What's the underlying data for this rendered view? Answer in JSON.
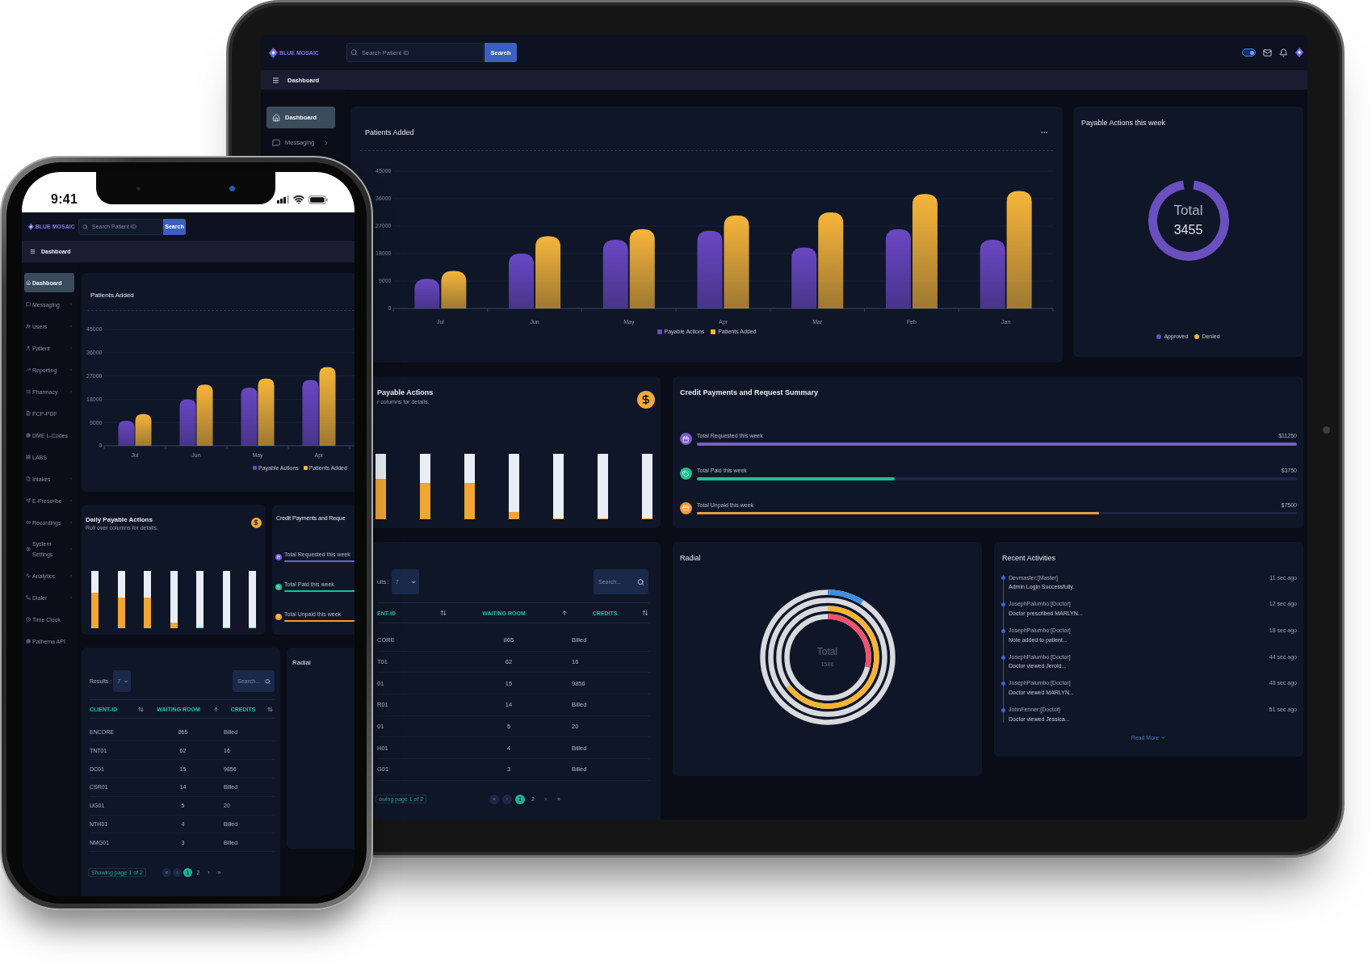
{
  "tablet": {
    "topbar": {
      "logo": "BLUE MOSAIC",
      "search_placeholder": "Search Patient ID",
      "search_button": "Search",
      "theme_toggle": {
        "on": true
      }
    },
    "breadcrumb": "Dashboard",
    "sidebar": [
      {
        "label": "Dashboard",
        "selected": true,
        "expandable": false
      },
      {
        "label": "Messaging",
        "selected": false,
        "expandable": true
      }
    ],
    "patients_added": {
      "title": "Patients Added",
      "chart_data": {
        "type": "bar",
        "categories": [
          "Jul",
          "Jun",
          "May",
          "Apr",
          "Mar",
          "Feb",
          "Jan"
        ],
        "series": [
          {
            "name": "Payable Actions",
            "color": "#6a47c4",
            "values": [
              9700,
              18000,
              22500,
              25500,
              20000,
              26000,
              22500
            ]
          },
          {
            "name": "Patients Added",
            "color": "#f6b53a",
            "values": [
              12300,
              23700,
              26000,
              30500,
              31500,
              37500,
              38500
            ]
          }
        ],
        "ylim": [
          0,
          45000
        ],
        "yticks": [
          0,
          9000,
          18000,
          27000,
          36000,
          45000
        ],
        "grid": true
      }
    },
    "payable_week": {
      "title": "Payable Actions this week",
      "total_label": "Total",
      "total_value": "3455",
      "legend": [
        {
          "label": "Approved",
          "color": "#6a4fbf"
        },
        {
          "label": "Denied",
          "color": "#f2b33d"
        }
      ]
    },
    "daily_payable": {
      "title": "Payable Actions",
      "subtitle": "r columns for details.",
      "bars": [
        {
          "level": 0.62
        },
        {
          "level": 0.55
        },
        {
          "level": 0.55
        },
        {
          "level": 0.11
        },
        {
          "level": 0
        },
        {
          "level": 0
        },
        {
          "level": 0
        }
      ]
    },
    "credit_summary": {
      "title": "Credit Payments and Request Summary",
      "rows": [
        {
          "label": "Total Requested this week",
          "value": "$11250",
          "level": 1,
          "color": "#7a5cd0"
        },
        {
          "label": "Total Paid this week",
          "value": "$3750",
          "level": 0.33,
          "color": "#1fc08e"
        },
        {
          "label": "Total Unpaid this week",
          "value": "$7500",
          "level": 0.67,
          "color": "#f39a3b"
        }
      ]
    },
    "table": {
      "results_label": "ults :",
      "results_value": "7",
      "search_placeholder": "Search...",
      "columns": [
        {
          "label": "ENT-ID",
          "kind": "sortable"
        },
        {
          "label": "WAITING ROOM",
          "kind": "ascending"
        },
        {
          "label": "CREDITS",
          "kind": "sortable"
        }
      ],
      "rows": [
        [
          "CORE",
          "865",
          "Billed"
        ],
        [
          "T01",
          "62",
          "16"
        ],
        [
          "01",
          "15",
          "9856"
        ],
        [
          "R01",
          "14",
          "Billed"
        ],
        [
          "01",
          "5",
          "20"
        ],
        [
          "H01",
          "4",
          "Billed"
        ],
        [
          "G01",
          "3",
          "Billed"
        ]
      ],
      "pagination": {
        "summary": "owing page 1 of 2",
        "buttons": [
          {
            "label": "«",
            "selected": false,
            "disabled": true
          },
          {
            "label": "‹",
            "selected": false,
            "disabled": true
          },
          {
            "label": "1",
            "selected": true,
            "disabled": false
          },
          {
            "label": "2",
            "selected": false,
            "disabled": false
          },
          {
            "label": "›",
            "selected": false,
            "disabled": false
          },
          {
            "label": "»",
            "selected": false,
            "disabled": false
          }
        ]
      }
    },
    "radial": {
      "title": "Radial",
      "center_label": "Total",
      "center_value": "1586"
    },
    "recent_activities": {
      "title": "Recent Activities",
      "items": [
        {
          "name": "Devmaster:[Master]",
          "text": "Admin Login Successfully.",
          "time": "11 sec ago"
        },
        {
          "name": "JosephPalumbo:[Doctor]",
          "text": "Doctor prescribed MARLYN...",
          "time": "12 sec ago"
        },
        {
          "name": "JosephPalumbo:[Doctor]",
          "text": "Note added to patient...",
          "time": "18 sec ago"
        },
        {
          "name": "JosephPalumbo:[Doctor]",
          "text": "Doctor viewed Jerold...",
          "time": "44 sec ago"
        },
        {
          "name": "JosephPalumbo:[Doctor]",
          "text": "Doctor viewed MARLYN...",
          "time": "48 sec ago"
        },
        {
          "name": "JohnFenner:[Doctor]",
          "text": "Doctor viewed Jessica...",
          "time": "51 sec ago"
        }
      ],
      "read_more": "Read More"
    }
  },
  "phone": {
    "status_bar": {
      "time": "9:41"
    },
    "topbar": {
      "logo": "BLUE MOSAIC",
      "search_placeholder": "Search Patient ID",
      "search_button": "Search"
    },
    "breadcrumb": "Dashboard",
    "sidebar": [
      {
        "label": "Dashboard",
        "selected": true,
        "expandable": false
      },
      {
        "label": "Messaging",
        "selected": false,
        "expandable": true
      },
      {
        "label": "Users",
        "selected": false,
        "expandable": true
      },
      {
        "label": "Patient",
        "selected": false,
        "expandable": true
      },
      {
        "label": "Reporting",
        "selected": false,
        "expandable": true
      },
      {
        "label": "Pharmacy",
        "selected": false,
        "expandable": true
      },
      {
        "label": "PCP-PDF",
        "selected": false,
        "expandable": false
      },
      {
        "label": "DME L-Codes",
        "selected": false,
        "expandable": false
      },
      {
        "label": "LABS",
        "selected": false,
        "expandable": false
      },
      {
        "label": "Intakes",
        "selected": false,
        "expandable": true
      },
      {
        "label": "E-Prescribe",
        "selected": false,
        "expandable": true
      },
      {
        "label": "Recordings",
        "selected": false,
        "expandable": true
      },
      {
        "label": "System Settings",
        "selected": false,
        "expandable": true
      },
      {
        "label": "Analytics",
        "selected": false,
        "expandable": true
      },
      {
        "label": "Dialer",
        "selected": false,
        "expandable": true
      },
      {
        "label": "Time Clock",
        "selected": false,
        "expandable": false
      },
      {
        "label": "Pathema API",
        "selected": false,
        "expandable": false
      }
    ],
    "patients_added": {
      "title": "Patients Added",
      "chart_data": {
        "type": "bar",
        "categories": [
          "Jul",
          "Jun",
          "May",
          "Apr"
        ],
        "series": [
          {
            "name": "Payable Actions",
            "color": "#6a47c4",
            "values": [
              9700,
              18000,
              22500,
              25500
            ]
          },
          {
            "name": "Patients Added",
            "color": "#f6b53a",
            "values": [
              12300,
              23700,
              26000,
              30500
            ]
          }
        ],
        "ylim": [
          0,
          45000
        ],
        "yticks": [
          0,
          9000,
          18000,
          27000,
          36000,
          45000
        ],
        "grid": true
      }
    },
    "daily_payable": {
      "title": "Daily Payable Actions",
      "subtitle": "Roll over columns for details.",
      "bars": [
        {
          "level": 0.62
        },
        {
          "level": 0.54
        },
        {
          "level": 0.54
        },
        {
          "level": 0.1
        },
        {
          "level": 0
        },
        {
          "level": 0
        },
        {
          "level": 0
        }
      ]
    },
    "credit_summary": {
      "title": "Credit Payments and Reque",
      "rows": [
        {
          "label": "Total Requested this week",
          "level": 1,
          "color": "#7a5cd0"
        },
        {
          "label": "Total Paid this week",
          "level": 1,
          "color": "#1fc08e"
        },
        {
          "label": "Total Unpaid this week",
          "level": 1,
          "color": "#f39a3b"
        }
      ]
    },
    "table": {
      "results_label": "Results :",
      "results_value": "7",
      "search_placeholder": "Search...",
      "columns": [
        {
          "label": "CLIENT-ID",
          "kind": "sortable"
        },
        {
          "label": "WAITING ROOM",
          "kind": "ascending"
        },
        {
          "label": "CREDITS",
          "kind": "sortable"
        }
      ],
      "rows": [
        [
          "ENCORE",
          "865",
          "Billed"
        ],
        [
          "TNT01",
          "62",
          "16"
        ],
        [
          "DC01",
          "15",
          "9856"
        ],
        [
          "CSR01",
          "14",
          "Billed"
        ],
        [
          "UG01",
          "5",
          "20"
        ],
        [
          "NTH01",
          "4",
          "Billed"
        ],
        [
          "NMG01",
          "3",
          "Billed"
        ]
      ],
      "pagination": {
        "summary": "Showing page 1 of 2",
        "buttons": [
          {
            "label": "«",
            "selected": false,
            "disabled": true
          },
          {
            "label": "‹",
            "selected": false,
            "disabled": true
          },
          {
            "label": "1",
            "selected": true,
            "disabled": false
          },
          {
            "label": "2",
            "selected": false,
            "disabled": false
          },
          {
            "label": "›",
            "selected": false,
            "disabled": false
          },
          {
            "label": "»",
            "selected": false,
            "disabled": false
          }
        ]
      }
    },
    "radial": {
      "title": "Radial"
    }
  }
}
